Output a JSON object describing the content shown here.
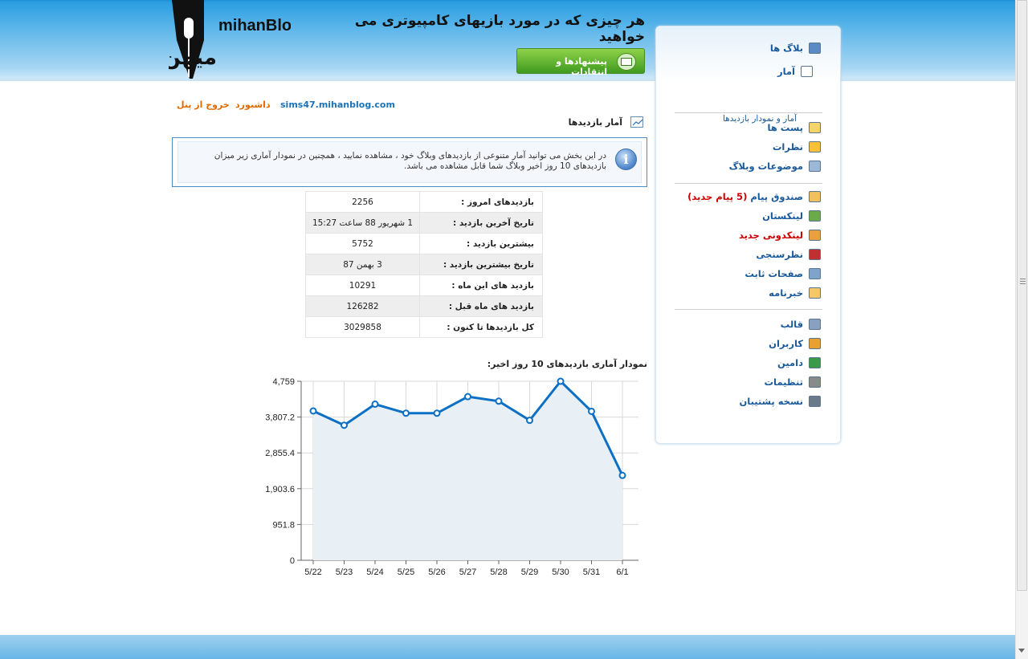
{
  "header": {
    "logo_text_latin": "mihanBlog",
    "logo_text_persian": "میهن بلاگ",
    "site_title": "هر چیزی که در مورد بازیهای کامپیوتری می خواهید",
    "feedback_button": "پیشنهادها و انتقادات"
  },
  "top_links": {
    "logout": "خروج از پنل",
    "dashboard": "داشبورد",
    "blog_address": "sims47.mihanblog.com"
  },
  "section": {
    "title": "آمار بازدیدها",
    "icon": "chart-icon"
  },
  "info": {
    "text": "در این بخش می توانید آمار متنوعی از بازدیدهای وبلاگ خود ، مشاهده نمایید ، همچنین در نمودار آماری زیر میزان بازدیدهای 10 روز اخیر وبلاگ شما قابل مشاهده می باشد."
  },
  "stats": [
    {
      "label": "بازدیدهای امروز :",
      "value": "2256"
    },
    {
      "label": "تاریخ آخرین بازدید :",
      "value": "1 شهریور 88 ساعت 15:27"
    },
    {
      "label": "بیشترین بازدید :",
      "value": "5752"
    },
    {
      "label": "تاریخ بیشترین بازدید :",
      "value": "3 بهمن 87"
    },
    {
      "label": "بازدید های این ماه :",
      "value": "10291"
    },
    {
      "label": "بازدید های ماه قبل :",
      "value": "126282"
    },
    {
      "label": "کل بازدیدها تا کنون :",
      "value": "3029858"
    }
  ],
  "chart_title": "نمودار آماری بازدیدهای 10 روز اخیر:",
  "chart_data": {
    "type": "area",
    "x": [
      "5/22",
      "5/23",
      "5/24",
      "5/25",
      "5/26",
      "5/27",
      "5/28",
      "5/29",
      "5/30",
      "5/31",
      "6/1"
    ],
    "series": [
      {
        "values": [
          3970,
          3590,
          4150,
          3910,
          3910,
          4350,
          4230,
          3720,
          4759,
          3960,
          2256
        ]
      }
    ],
    "yticks": [
      "4,759",
      "3,807.2",
      "2,855.4",
      "1,903.6",
      "951.8",
      "0"
    ],
    "ylim": [
      0,
      4759
    ],
    "grid": true,
    "colors": {
      "line": "#0d70c4",
      "fill": "#e8f0f6",
      "grid": "#d8d8d8"
    }
  },
  "sidebar": {
    "items": [
      {
        "label": "بلاگ ها",
        "icon": "blogs-icon"
      },
      {
        "label": "آمار",
        "icon": "stats-icon"
      },
      {
        "label": "پست ها",
        "icon": "posts-icon"
      },
      {
        "label": "نظرات",
        "icon": "comments-icon"
      },
      {
        "label": "موضوعات وبلاگ",
        "icon": "folder-icon"
      },
      {
        "label": "صندوق پیام",
        "badge": "(5 پیام جدید)",
        "icon": "inbox-icon"
      },
      {
        "label": "لینکستان",
        "icon": "links-icon"
      },
      {
        "label": "لینکدونی جدید",
        "icon": "new-links-icon"
      },
      {
        "label": "نظرسنجی",
        "icon": "poll-icon"
      },
      {
        "label": "صفحات ثابت",
        "icon": "pages-icon"
      },
      {
        "label": "خبرنامه",
        "icon": "newsletter-icon"
      },
      {
        "label": "قالب",
        "icon": "template-icon"
      },
      {
        "label": "کاربران",
        "icon": "users-icon"
      },
      {
        "label": "دامین",
        "icon": "domain-icon"
      },
      {
        "label": "تنظیمات",
        "icon": "settings-icon"
      },
      {
        "label": "نسخه پشتیبان",
        "icon": "backup-icon"
      }
    ],
    "sub_item": "آمار و نمودار بازدیدها"
  }
}
